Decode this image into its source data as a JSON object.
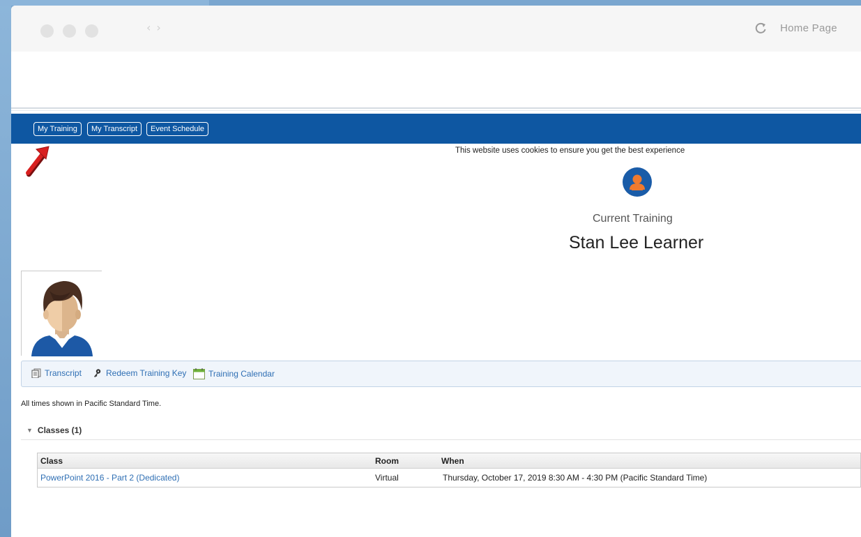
{
  "browser": {
    "home_link": "Home Page"
  },
  "navbar": {
    "buttons": [
      {
        "label": "My Training"
      },
      {
        "label": "My Transcript"
      },
      {
        "label": "Event Schedule"
      }
    ]
  },
  "banner": {
    "cookie_notice": "This website uses cookies to ensure you get the best experience"
  },
  "profile": {
    "section_title": "Current Training",
    "learner_name": "Stan Lee Learner"
  },
  "toolbar": {
    "items": [
      {
        "label": "Transcript",
        "icon": "document-icon"
      },
      {
        "label": "Redeem Training Key",
        "icon": "key-icon"
      },
      {
        "label": "Training Calendar",
        "icon": "calendar-icon"
      }
    ]
  },
  "timezone_note": "All times shown in Pacific Standard Time.",
  "classes": {
    "toggle_label": "Classes (1)",
    "columns": [
      "Class",
      "Room",
      "When"
    ],
    "rows": [
      {
        "class": "PowerPoint 2016 - Part 2 (Dedicated)",
        "room": "Virtual",
        "when": "Thursday, October 17, 2019 8:30 AM - 4:30 PM (Pacific Standard Time)"
      }
    ]
  },
  "colors": {
    "navbar": "#0e57a2",
    "link": "#2f6fb4",
    "arrow": "#d81f1f"
  }
}
